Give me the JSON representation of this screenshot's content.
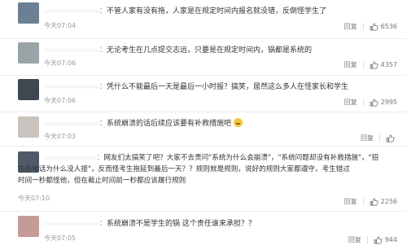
{
  "comments": [
    {
      "username": "————————",
      "lines": [
        "不管人家有没有拖，人家是在规定时间内报名就没错，反倒怪学生了"
      ],
      "time": "今天07:04",
      "reply": "回复",
      "likes": "6536",
      "avatar_color": "#6d7f93"
    },
    {
      "username": "————————",
      "lines": [
        "无论考生在几点提交志远，只要是在规定时间内，锅都是系统的"
      ],
      "time": "今天07:06",
      "reply": "回复",
      "likes": "4357",
      "avatar_color": "#9aa4a6"
    },
    {
      "username": "————————",
      "lines": [
        "凭什么不能最后一天是最后一小时报？搞笑，居然这么多人在怪家长和学生"
      ],
      "time": "今天07:06",
      "reply": "回复",
      "likes": "2995",
      "avatar_color": "#3f4752"
    },
    {
      "username": "————————",
      "lines": [
        "系统崩溃的话后续应该要有补救措施吧"
      ],
      "time": "今天07:03",
      "reply": "回复",
      "likes": "",
      "avatar_color": "#c9c3bd"
    },
    {
      "username": "————————",
      "lines": [
        "网友们太搞笑了吧？大家不去责问\"系统为什么会崩溃\"，\"系统问题却没有补救措施\"，\"招",
        "生办电话为什么没人接\"，反而怪考生拖延到最后一天？？规则就是规则，说好的规则大家都遵守，考生错过",
        "时间一秒都怪他，但在截止时间前一秒都应该履行规则"
      ],
      "time": "今天07:10",
      "reply": "回复",
      "likes": "2256",
      "avatar_color": "#505a68"
    },
    {
      "username": "————————",
      "lines": [
        "系统崩溃不是学生的锅 这个责任谁来承担？？"
      ],
      "time": "今天07:05",
      "reply": "回复",
      "likes": "944",
      "avatar_color": "#c59b98"
    }
  ],
  "colors": {
    "accent": "#eb7350",
    "text": "#333333",
    "muted": "#999999"
  },
  "icons": {
    "thumb": "thumbs-up-icon",
    "emoji": "sweat-smile-emoji-icon"
  }
}
